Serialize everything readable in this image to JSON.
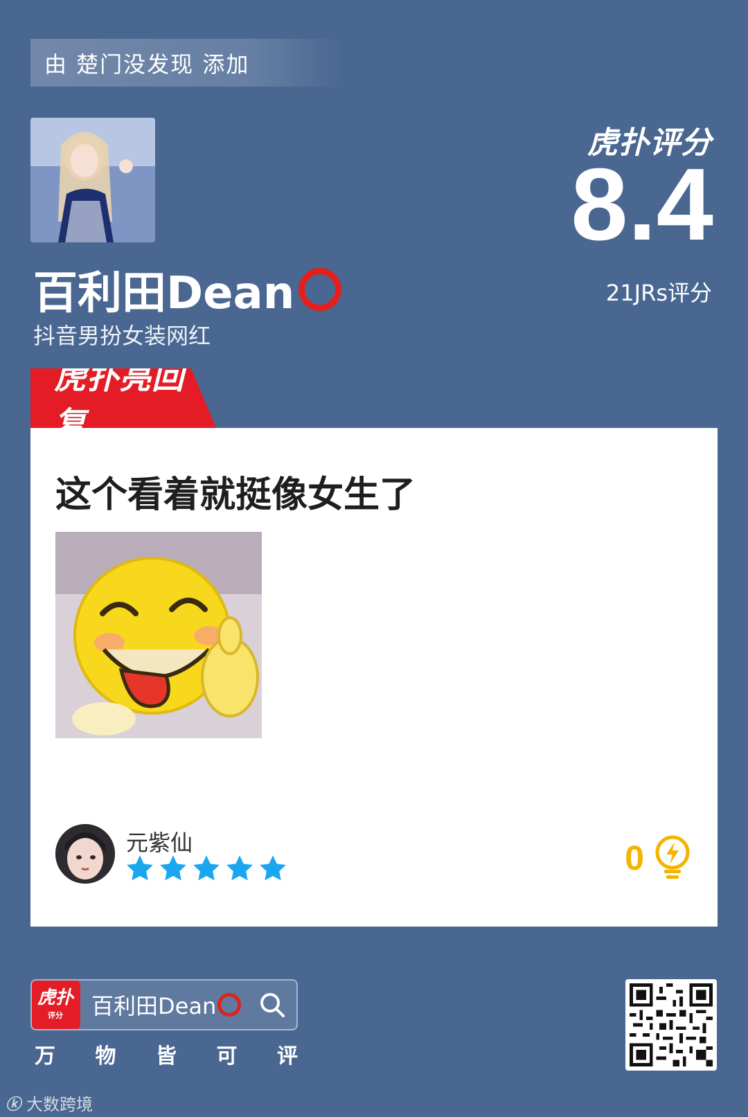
{
  "header": {
    "added_by_text": "由 楚门没发现 添加"
  },
  "profile": {
    "name": "百利田Dean",
    "subtitle": "抖音男扮女装网红"
  },
  "score": {
    "brand": "虎扑评分",
    "value": "8.4",
    "count_text": "21JRs评分"
  },
  "hot_reply": {
    "tag_label": "虎扑亮回复",
    "text": "这个看着就挺像女生了",
    "user": {
      "name": "元紫仙",
      "rating_stars": 5
    },
    "likes": "0"
  },
  "footer": {
    "app_logo_text": "虎扑",
    "app_logo_sub": "评分",
    "search_text": "百利田Dean",
    "slogan": [
      "万",
      "物",
      "皆",
      "可",
      "评"
    ],
    "watermark": "大数跨境"
  },
  "colors": {
    "background": "#4a6792",
    "accent_red": "#e41c26",
    "star_blue": "#1aa6f0",
    "like_yellow": "#f4b400"
  },
  "icons": [
    "search-icon",
    "lightbulb-icon",
    "star-icon",
    "qr-code"
  ]
}
